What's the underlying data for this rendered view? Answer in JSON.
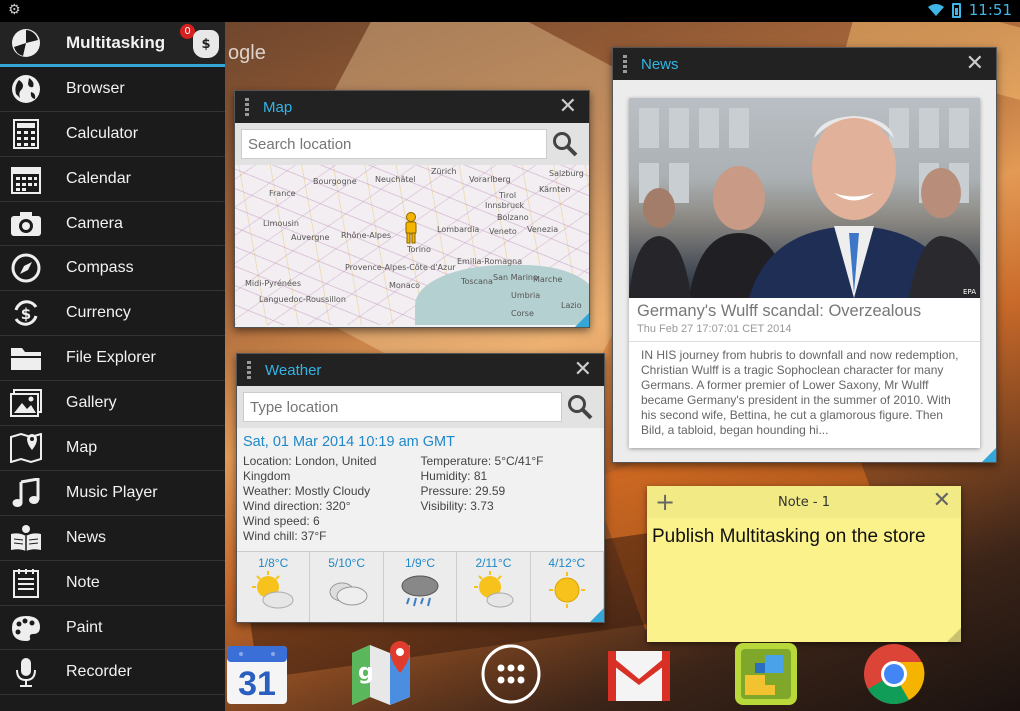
{
  "status_bar": {
    "time": "11:51"
  },
  "wallpaper": {
    "text": "ogle"
  },
  "sidebar": {
    "items": [
      {
        "label": "Multitasking",
        "icon": "multitasking-icon"
      },
      {
        "label": "Browser",
        "icon": "globe-icon"
      },
      {
        "label": "Calculator",
        "icon": "calculator-icon"
      },
      {
        "label": "Calendar",
        "icon": "calendar-icon"
      },
      {
        "label": "Camera",
        "icon": "camera-icon"
      },
      {
        "label": "Compass",
        "icon": "compass-icon"
      },
      {
        "label": "Currency",
        "icon": "currency-icon"
      },
      {
        "label": "File Explorer",
        "icon": "folder-icon"
      },
      {
        "label": "Gallery",
        "icon": "gallery-icon"
      },
      {
        "label": "Map",
        "icon": "map-icon"
      },
      {
        "label": "Music Player",
        "icon": "music-icon"
      },
      {
        "label": "News",
        "icon": "newspaper-icon"
      },
      {
        "label": "Note",
        "icon": "note-icon"
      },
      {
        "label": "Paint",
        "icon": "palette-icon"
      },
      {
        "label": "Recorder",
        "icon": "microphone-icon"
      }
    ],
    "badge_count": "0",
    "money_symbol": "$"
  },
  "map_widget": {
    "title": "Map",
    "search_placeholder": "Search location",
    "labels": [
      "France",
      "Bourgogne",
      "Neuchâtel",
      "Zürich",
      "Vorarlberg",
      "Tirol",
      "Kärnten",
      "Salzburg",
      "Innsbruck",
      "Bolzano",
      "Limousin",
      "Auvergne",
      "Rhône-Alpes",
      "Lombardia",
      "Veneto",
      "Venezia",
      "Torino",
      "Emilia-Romagna",
      "Toscana",
      "Marche",
      "Umbria",
      "Midi-Pyrénées",
      "Provence-Alpes-Côte d'Azur",
      "Monaco",
      "Languedoc-Roussillon",
      "San Marino",
      "Corse",
      "Lazio"
    ]
  },
  "weather_widget": {
    "title": "Weather",
    "search_placeholder": "Type location",
    "date": "Sat, 01 Mar 2014 10:19 am GMT",
    "left": [
      "Location: London, United Kingdom",
      "Weather: Mostly Cloudy",
      "Wind direction: 320°",
      "Wind speed: 6",
      "Wind chill: 37°F"
    ],
    "right": [
      "Temperature: 5°C/41°F",
      "Humidity: 81",
      "Pressure: 29.59",
      "Visibility: 3.73"
    ],
    "forecast": [
      {
        "temp": "1/8°C",
        "icon": "sun-cloud-icon"
      },
      {
        "temp": "5/10°C",
        "icon": "cloud-icon"
      },
      {
        "temp": "1/9°C",
        "icon": "rain-cloud-icon"
      },
      {
        "temp": "2/11°C",
        "icon": "sun-cloud-icon"
      },
      {
        "temp": "4/12°C",
        "icon": "sun-icon"
      }
    ]
  },
  "news_widget": {
    "title": "News",
    "headline": "Germany's Wulff scandal: Overzealous",
    "date": "Thu Feb 27 17:07:01 CET 2014",
    "body": "IN HIS journey from hubris to downfall and now redemption, Christian Wulff is a tragic Sophoclean character for many Germans. A former premier of Lower Saxony, Mr Wulff became Germany's president in the summer of 2010. With his second wife, Bettina, he cut a glamorous figure. Then Bild, a tabloid, began hounding hi...",
    "photo_credit": "EPA"
  },
  "note_widget": {
    "title": "Note - 1",
    "text": "Publish Multitasking on the store"
  },
  "dock": {
    "calendar_day": "31",
    "items": [
      "calendar-app-icon",
      "maps-app-icon",
      "app-drawer-icon",
      "gmail-app-icon",
      "game-app-icon",
      "chrome-app-icon"
    ]
  },
  "colors": {
    "accent": "#33b5e5",
    "note": "#fbf28c",
    "badge": "#d62020"
  }
}
